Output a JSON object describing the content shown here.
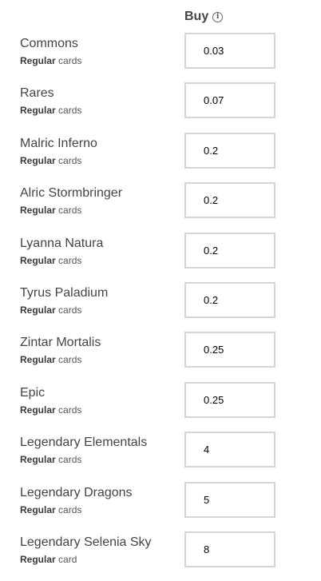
{
  "header": {
    "buy_label": "Buy",
    "info_icon": "info-icon",
    "info_glyph": "i"
  },
  "rows": [
    {
      "name": "Commons",
      "qualifier": "Regular",
      "kind": "cards",
      "buy_value": "0.03"
    },
    {
      "name": "Rares",
      "qualifier": "Regular",
      "kind": "cards",
      "buy_value": "0.07"
    },
    {
      "name": "Malric Inferno",
      "qualifier": "Regular",
      "kind": "cards",
      "buy_value": "0.2"
    },
    {
      "name": "Alric Stormbringer",
      "qualifier": "Regular",
      "kind": "cards",
      "buy_value": "0.2"
    },
    {
      "name": "Lyanna Natura",
      "qualifier": "Regular",
      "kind": "cards",
      "buy_value": "0.2"
    },
    {
      "name": "Tyrus Paladium",
      "qualifier": "Regular",
      "kind": "cards",
      "buy_value": "0.2"
    },
    {
      "name": "Zintar Mortalis",
      "qualifier": "Regular",
      "kind": "cards",
      "buy_value": "0.25"
    },
    {
      "name": "Epic",
      "qualifier": "Regular",
      "kind": "cards",
      "buy_value": "0.25"
    },
    {
      "name": "Legendary Elementals",
      "qualifier": "Regular",
      "kind": "cards",
      "buy_value": "4"
    },
    {
      "name": "Legendary Dragons",
      "qualifier": "Regular",
      "kind": "cards",
      "buy_value": "5"
    },
    {
      "name": "Legendary Selenia Sky",
      "qualifier": "Regular",
      "kind": "card",
      "buy_value": "8"
    }
  ]
}
